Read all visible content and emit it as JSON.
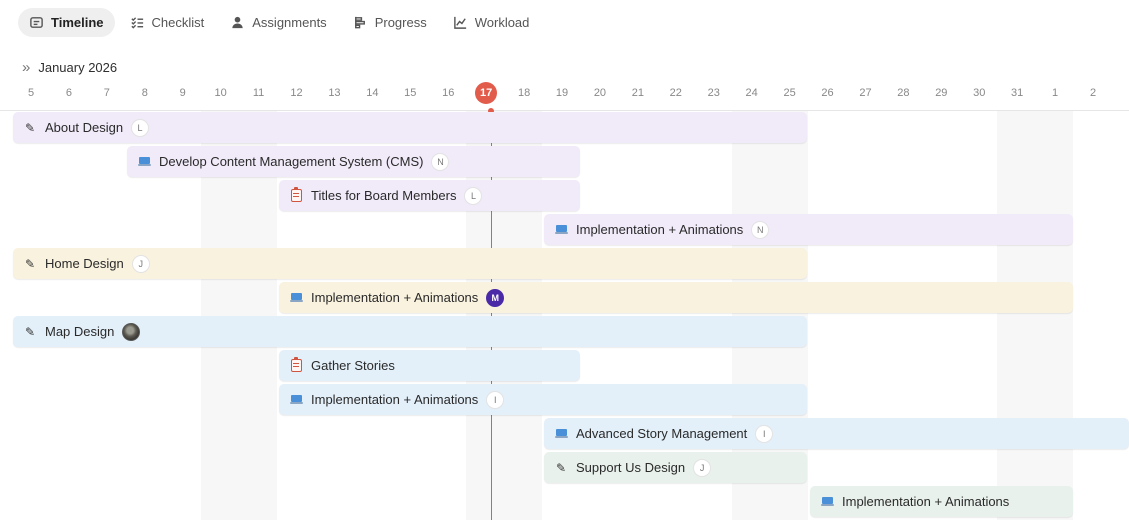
{
  "tabs": [
    {
      "label": "Timeline",
      "icon": "timeline-icon",
      "active": true
    },
    {
      "label": "Checklist",
      "icon": "checklist-icon",
      "active": false
    },
    {
      "label": "Assignments",
      "icon": "person-icon",
      "active": false
    },
    {
      "label": "Progress",
      "icon": "progress-icon",
      "active": false
    },
    {
      "label": "Workload",
      "icon": "chart-icon",
      "active": false
    }
  ],
  "month": {
    "label": "January 2026",
    "expand_icon": "double-chevron-right-icon"
  },
  "days": [
    "5",
    "6",
    "7",
    "8",
    "9",
    "10",
    "11",
    "12",
    "13",
    "14",
    "15",
    "16",
    "17",
    "18",
    "19",
    "20",
    "21",
    "22",
    "23",
    "24",
    "25",
    "26",
    "27",
    "28",
    "29",
    "30",
    "31",
    "1",
    "2"
  ],
  "today": "17",
  "colors": {
    "today": "#e25c4c",
    "purple": "#f1eaf9",
    "yellow": "#f8f2de",
    "blue": "#e3eff9",
    "green": "#e8f1ec"
  },
  "tasks": [
    {
      "title": "About Design",
      "icon": "brush-icon",
      "assignee": "L",
      "color": "purple"
    },
    {
      "title": "Develop Content Management System (CMS)",
      "icon": "laptop-icon",
      "assignee": "N",
      "color": "purple"
    },
    {
      "title": "Titles for Board Members",
      "icon": "clipboard-icon",
      "assignee": "L",
      "color": "purple"
    },
    {
      "title": "Implementation + Animations",
      "icon": "laptop-icon",
      "assignee": "N",
      "color": "purple"
    },
    {
      "title": "Home Design",
      "icon": "brush-icon",
      "assignee": "J",
      "color": "yellow"
    },
    {
      "title": "Implementation + Animations",
      "icon": "laptop-icon",
      "assignee": "M",
      "color": "yellow"
    },
    {
      "title": "Map Design",
      "icon": "brush-icon",
      "assignee": "",
      "color": "blue"
    },
    {
      "title": "Gather Stories",
      "icon": "clipboard-icon",
      "assignee": "",
      "color": "blue"
    },
    {
      "title": "Implementation + Animations",
      "icon": "laptop-icon",
      "assignee": "I",
      "color": "blue"
    },
    {
      "title": "Advanced Story Management",
      "icon": "laptop-icon",
      "assignee": "I",
      "color": "blue"
    },
    {
      "title": "Support Us Design",
      "icon": "brush-icon",
      "assignee": "J",
      "color": "green"
    },
    {
      "title": "Implementation + Animations",
      "icon": "laptop-icon",
      "assignee": "",
      "color": "green"
    }
  ]
}
